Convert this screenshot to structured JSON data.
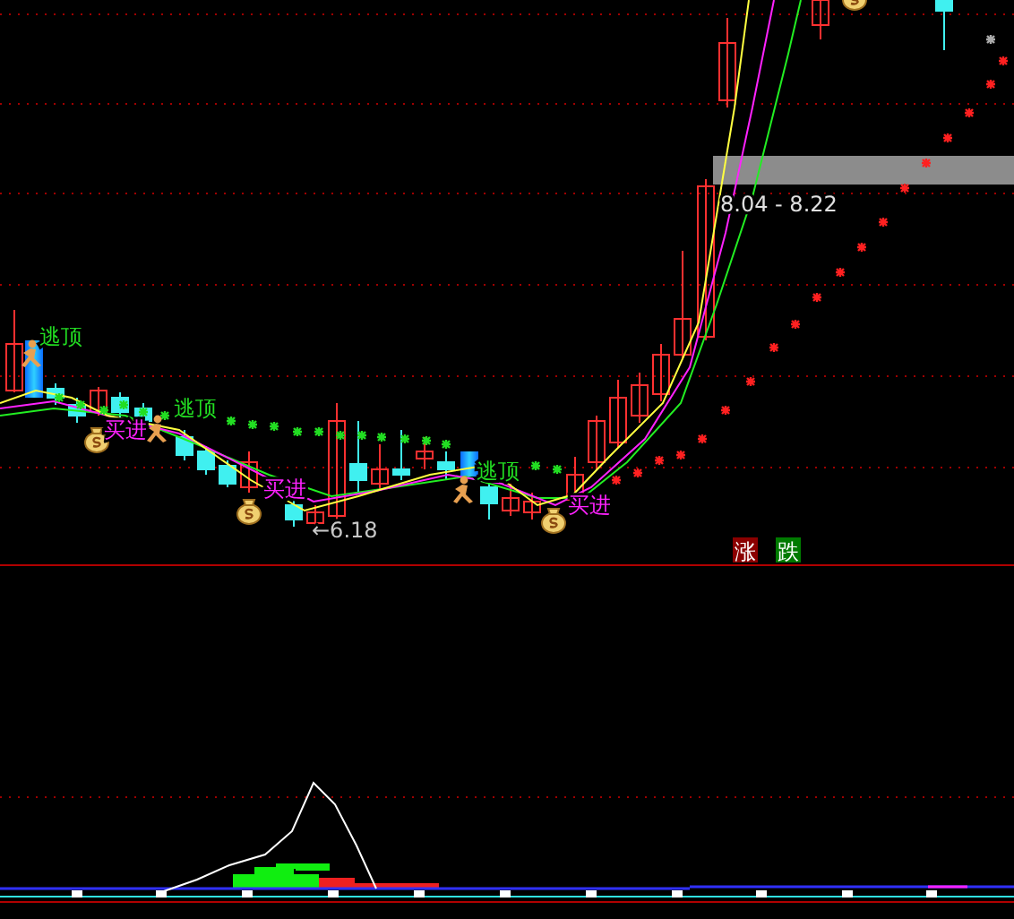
{
  "signals": [
    {
      "kind": "sell",
      "label": "逃顶"
    },
    {
      "kind": "buy",
      "label": "买进"
    },
    {
      "kind": "sell",
      "label": "逃顶"
    },
    {
      "kind": "buy",
      "label": "买进"
    },
    {
      "kind": "sell",
      "label": "逃顶"
    },
    {
      "kind": "buy",
      "label": "买进"
    }
  ],
  "price_labels": [
    {
      "kind": "low",
      "label": "←6.18"
    },
    {
      "kind": "range",
      "label": "8.04 - 8.22"
    }
  ],
  "legend": [
    {
      "label": "涨",
      "color": "#8b0000"
    },
    {
      "label": "跌",
      "color": "#007a00"
    }
  ]
}
